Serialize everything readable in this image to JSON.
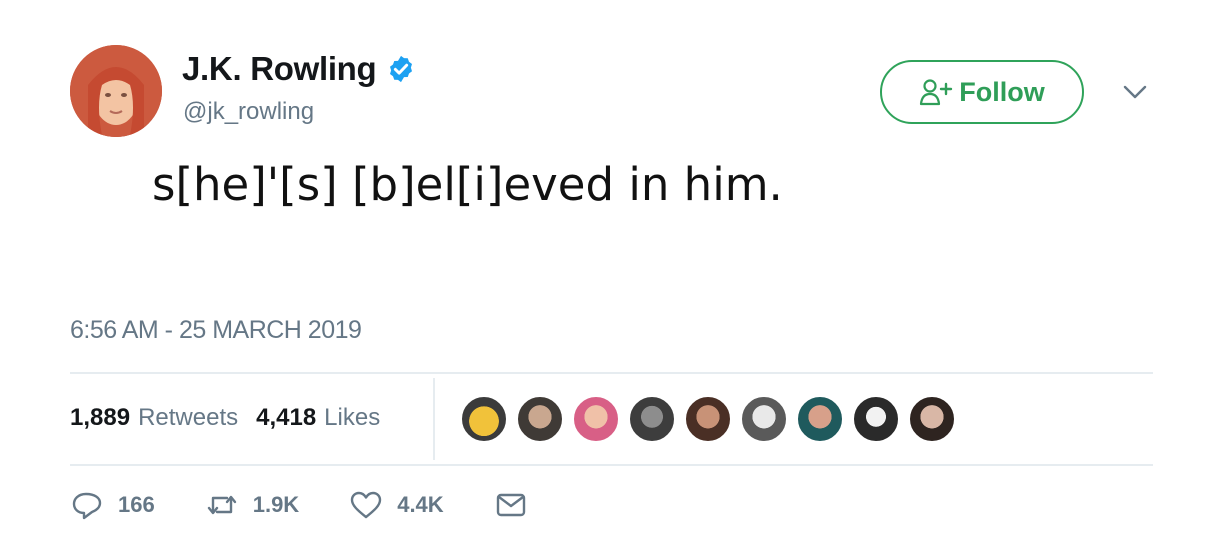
{
  "header": {
    "display_name": "J.K. Rowling",
    "handle": "@jk_rowling",
    "follow_label": "Follow"
  },
  "tweet": {
    "text": "s[he]'[s] [b]el[i]eved in him.",
    "time": "6:56 AM - 25 MARCH 2019"
  },
  "stats": {
    "retweets_count": "1,889",
    "retweets_label": "Retweets",
    "likes_count": "4,418",
    "likes_label": "Likes"
  },
  "actions": {
    "reply_count": "166",
    "retweet_count": "1.9K",
    "like_count": "4.4K"
  },
  "colors": {
    "verified_blue": "#1da1f2",
    "follow_green": "#2f9e58",
    "muted_gray": "#657786"
  },
  "icons": [
    "verified-icon",
    "follow-person-plus-icon",
    "chevron-down-icon",
    "reply-icon",
    "retweet-icon",
    "like-heart-icon",
    "message-icon"
  ]
}
